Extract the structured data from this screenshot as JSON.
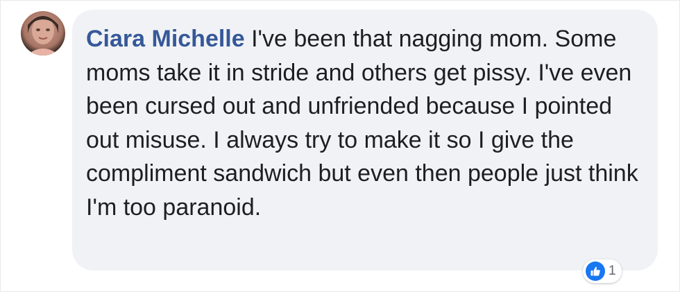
{
  "comment": {
    "author": "Ciara Michelle",
    "body": " I've been that nagging mom. Some moms take it in stride and others get pissy. I've even been cursed out and unfriended because I pointed out misuse. I always try to make it so I give the compliment sandwich but even then people just think I'm too paranoid.",
    "reaction_icon": "like-icon",
    "reaction_count": "1"
  },
  "colors": {
    "author": "#365899",
    "text": "#1c1e21",
    "bubble": "#f0f2f5",
    "like": "#1877f2"
  }
}
